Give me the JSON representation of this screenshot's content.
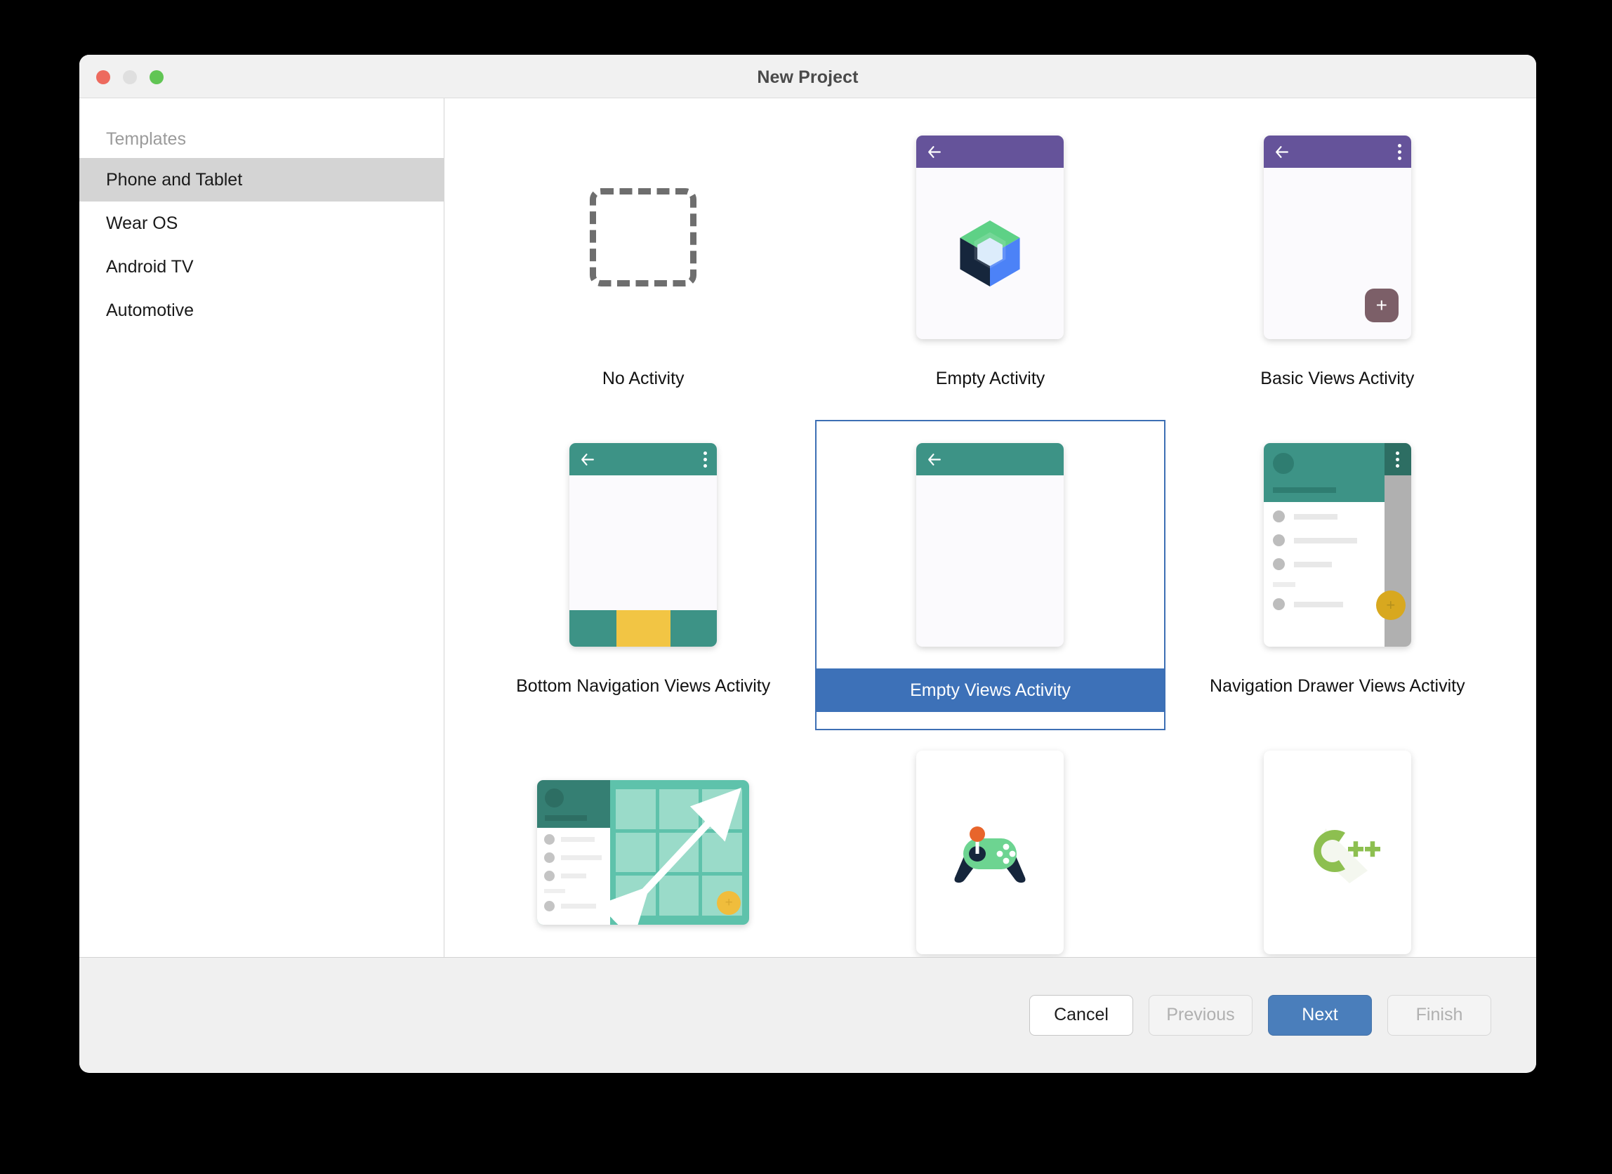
{
  "window": {
    "title": "New Project",
    "traffic_lights": [
      {
        "name": "close",
        "color": "#ed6a5e"
      },
      {
        "name": "minimize",
        "color": "#dfdfdf"
      },
      {
        "name": "maximize",
        "color": "#61c554"
      }
    ]
  },
  "sidebar": {
    "header": "Templates",
    "items": [
      {
        "label": "Phone and Tablet",
        "selected": true
      },
      {
        "label": "Wear OS",
        "selected": false
      },
      {
        "label": "Android TV",
        "selected": false
      },
      {
        "label": "Automotive",
        "selected": false
      }
    ]
  },
  "templates": [
    {
      "label": "No Activity",
      "icon": "dashed-square-icon",
      "selected": false
    },
    {
      "label": "Empty Activity",
      "icon": "jetpack-compose-logo-icon",
      "selected": false
    },
    {
      "label": "Basic Views Activity",
      "icon": "phone-toolbar-fab-icon",
      "selected": false
    },
    {
      "label": "Bottom Navigation Views Activity",
      "icon": "phone-bottom-nav-icon",
      "selected": false
    },
    {
      "label": "Empty Views Activity",
      "icon": "phone-toolbar-icon",
      "selected": true
    },
    {
      "label": "Navigation Drawer Views Activity",
      "icon": "phone-nav-drawer-icon",
      "selected": false
    },
    {
      "label": "",
      "icon": "responsive-tablet-grid-icon",
      "selected": false
    },
    {
      "label": "",
      "icon": "gamepad-icon",
      "selected": false
    },
    {
      "label": "",
      "icon": "cplusplus-logo-icon",
      "selected": false
    }
  ],
  "footer": {
    "buttons": [
      {
        "label": "Cancel",
        "state": "enabled"
      },
      {
        "label": "Previous",
        "state": "disabled"
      },
      {
        "label": "Next",
        "state": "primary"
      },
      {
        "label": "Finish",
        "state": "disabled"
      }
    ]
  },
  "colors": {
    "accent_blue": "#4a7ebb",
    "selection_blue": "#3d71b8",
    "toolbar_purple": "#65539a",
    "toolbar_teal": "#3d9386",
    "nav_yellow": "#f2c544",
    "fab_mauve": "#7c5f68",
    "fab_gold": "#d8a81f",
    "sidebar_selected": "#d4d4d4"
  }
}
